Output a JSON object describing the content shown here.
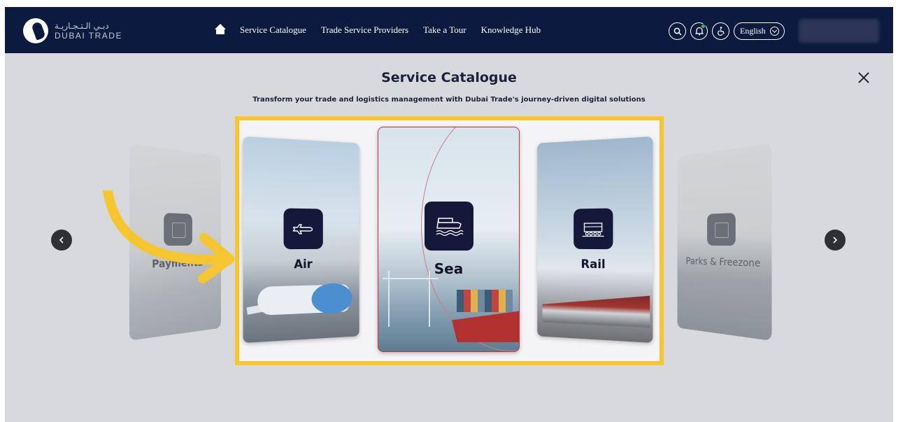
{
  "header": {
    "logo_arabic": "دبـي الـتـجـاريـة",
    "logo_english": "DUBAI TRADE",
    "nav_items": [
      "Service Catalogue",
      "Trade Service Providers",
      "Take a Tour",
      "Knowledge Hub"
    ],
    "language": "English"
  },
  "catalogue": {
    "title": "Service Catalogue",
    "subtitle": "Transform your trade and logistics management with Dubai Trade's journey-driven digital solutions",
    "cards": [
      {
        "label": "Payments",
        "icon": "payments-icon"
      },
      {
        "label": "Air",
        "icon": "airplane-icon"
      },
      {
        "label": "Sea",
        "icon": "ship-icon"
      },
      {
        "label": "Rail",
        "icon": "train-icon"
      },
      {
        "label": "Parks & Freezone",
        "icon": "parks-icon"
      }
    ],
    "highlight_color": "#f6c630",
    "navy": "#14193a"
  }
}
